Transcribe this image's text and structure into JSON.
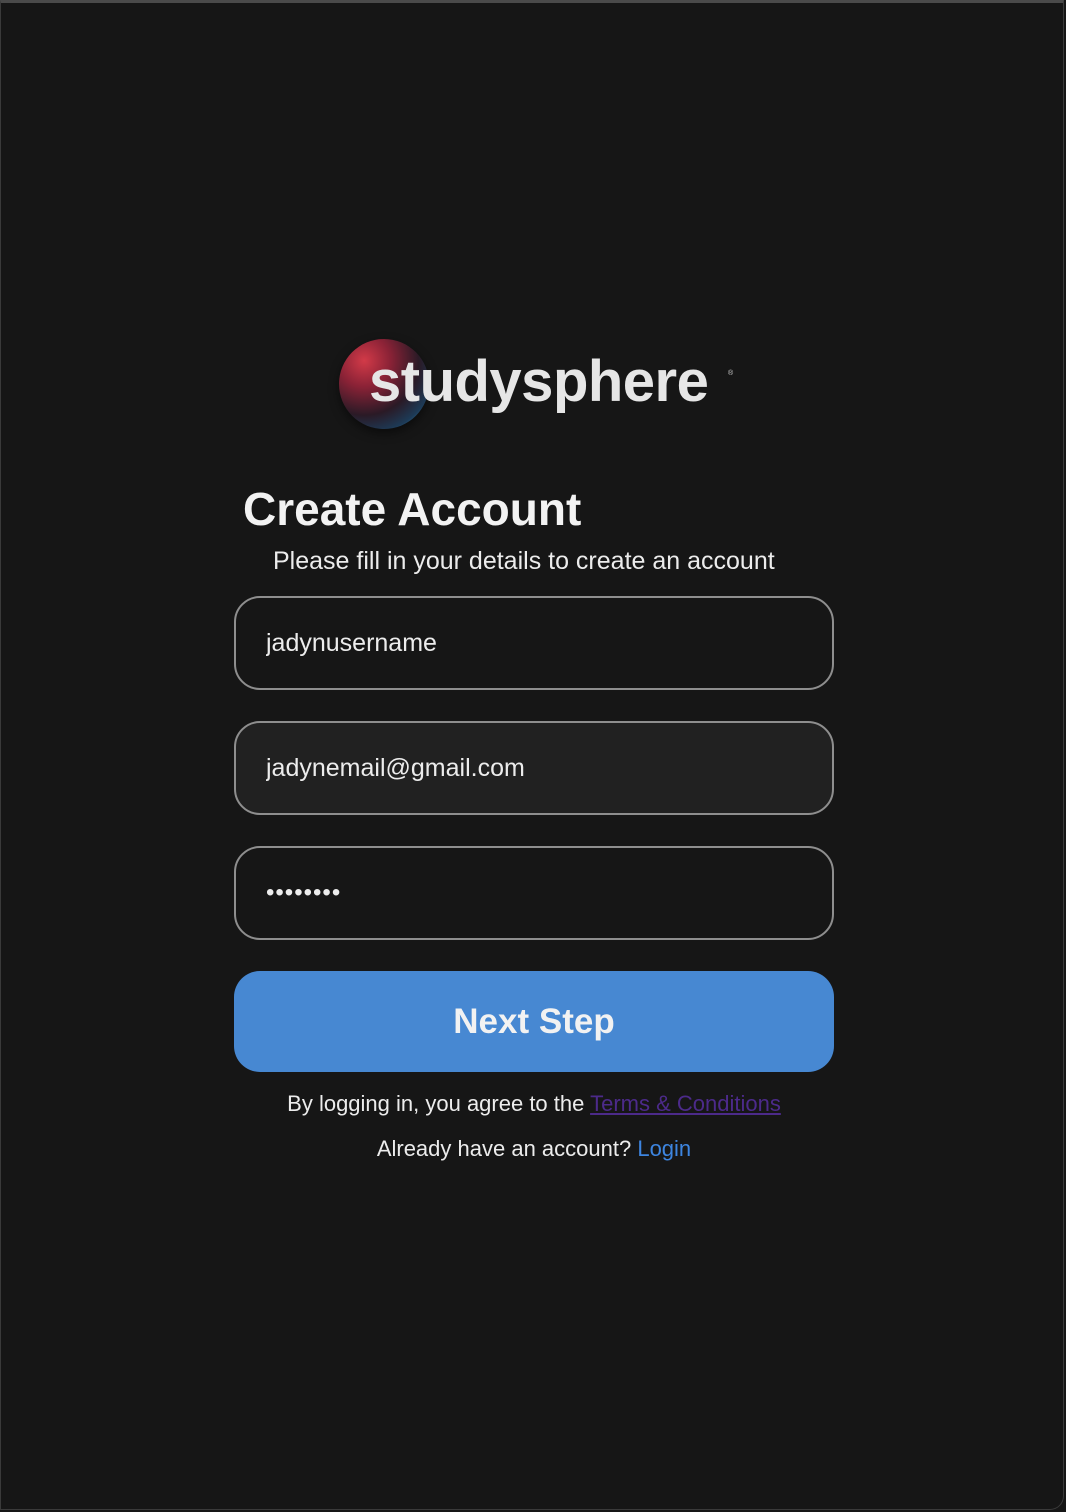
{
  "brand": {
    "name": "studysphere",
    "trademark": "®"
  },
  "header": {
    "title": "Create Account",
    "subtitle": "Please fill in your details to create an account"
  },
  "form": {
    "username_value": "jadynusername",
    "email_value": "jadynemail@gmail.com",
    "password_value": "password"
  },
  "actions": {
    "next_label": "Next Step"
  },
  "footer": {
    "terms_prefix": "By logging in, you agree to the ",
    "terms_link": "Terms & Conditions",
    "login_prefix": "Already have an account? ",
    "login_link": "Login"
  },
  "colors": {
    "background": "#161616",
    "primary_button": "#4788d2",
    "terms_link": "#4c2a8a",
    "login_link": "#3d85e0"
  }
}
